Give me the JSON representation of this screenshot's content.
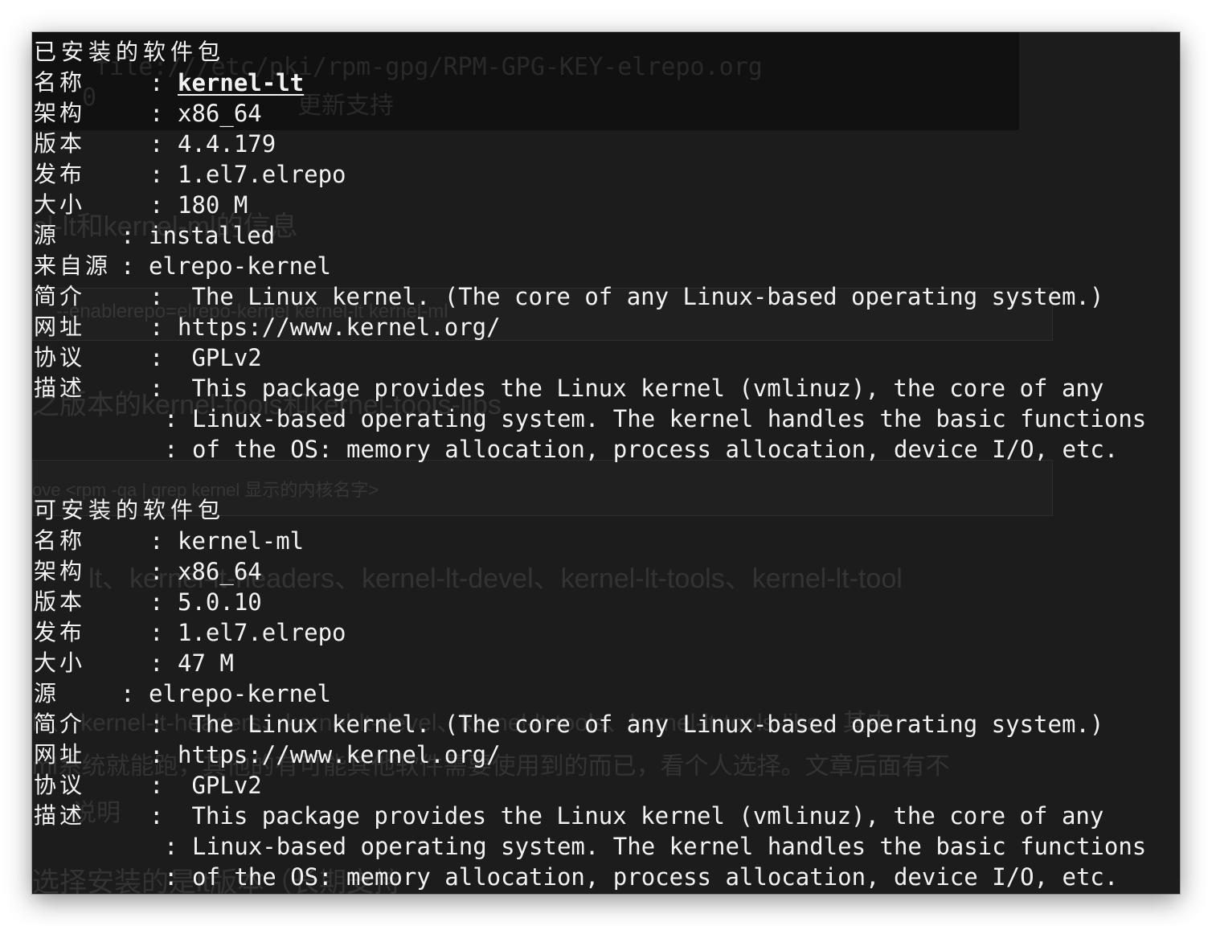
{
  "background_texts": {
    "path": "file:///etc/pki/rpm-gpg/RPM-GPG-KEY-elrepo.org",
    "zero": "0",
    "update_support": "更新支持",
    "info_title": "el-lt和kernel-ml的信息",
    "enablerepo": "--enablerepo=elrepo-kernel kernel-lt kernel-ml",
    "version_tools": "之版本的kernel-tools和kernel-tools-libs",
    "remove_hint": "ove <rpm -qa | grep kernel 显示的内核名字>",
    "packages": "lt、kernel-lt-headers、kernel-lt-devel、kernel-lt-tools、kernel-lt-tool",
    "note1": "ls、 kernel-lt-headers、kernel-lt-devel、kernel-lt-tools、kernel-lt-tools-libs，其中",
    "note2": "ml系统就能跑，其他的有可能其他软件需要使用到的而已，看个人选择。文章后面有不",
    "note3": "说明",
    "select_install": "选择安装的是lt版本（长期支持"
  },
  "installed": {
    "heading": "已安装的软件包",
    "name_label": "名称",
    "name_value": "kernel-lt",
    "arch_label": "架构",
    "arch_value": "x86_64",
    "version_label": "版本",
    "version_value": "4.4.179",
    "release_label": "发布",
    "release_value": "1.el7.elrepo",
    "size_label": "大小",
    "size_value": "180 M",
    "source_label": "源",
    "source_value": "installed",
    "from_repo_label": "来自源",
    "from_repo_value": "elrepo-kernel",
    "summary_label": "简介",
    "summary_value": " The Linux kernel. (The core of any Linux-based operating system.)",
    "url_label": "网址",
    "url_value": "https://www.kernel.org/",
    "license_label": "协议",
    "license_value": " GPLv2",
    "desc_label": "描述",
    "desc_line1": " This package provides the Linux kernel (vmlinuz), the core of any",
    "desc_line2": "Linux-based operating system. The kernel handles the basic functions",
    "desc_line3": "of the OS: memory allocation, process allocation, device I/O, etc."
  },
  "available": {
    "heading": "可安装的软件包",
    "name_label": "名称",
    "name_value": "kernel-ml",
    "arch_label": "架构",
    "arch_value": "x86_64",
    "version_label": "版本",
    "version_value": "5.0.10",
    "release_label": "发布",
    "release_value": "1.el7.elrepo",
    "size_label": "大小",
    "size_value": "47 M",
    "source_label": "源",
    "source_value": "elrepo-kernel",
    "summary_label": "简介",
    "summary_value": " The Linux kernel. (The core of any Linux-based operating system.)",
    "url_label": "网址",
    "url_value": "https://www.kernel.org/",
    "license_label": "协议",
    "license_value": " GPLv2",
    "desc_label": "描述",
    "desc_line1": " This package provides the Linux kernel (vmlinuz), the core of any",
    "desc_line2": "Linux-based operating system. The kernel handles the basic functions",
    "desc_line3": "of the OS: memory allocation, process allocation, device I/O, etc."
  },
  "colon": ":",
  "colors": {
    "terminal_bg": "#1c1c1c",
    "terminal_fg": "#f2f2f2"
  }
}
